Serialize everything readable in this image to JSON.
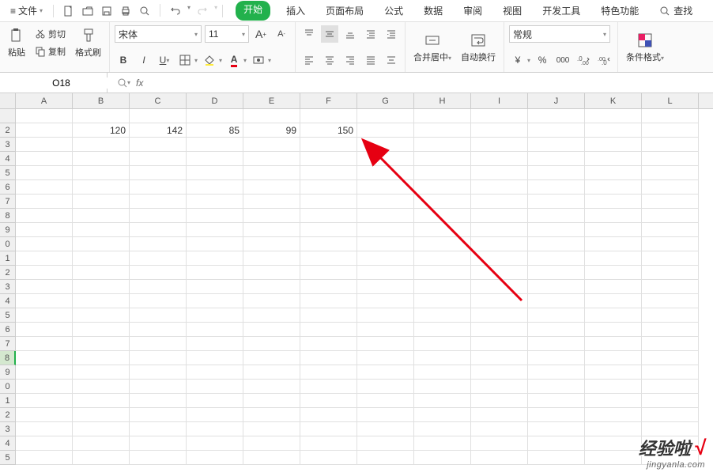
{
  "menu": {
    "file": "文件",
    "tabs": [
      "开始",
      "插入",
      "页面布局",
      "公式",
      "数据",
      "审阅",
      "视图",
      "开发工具",
      "特色功能"
    ],
    "active_tab": 0,
    "search": "查找"
  },
  "clipboard": {
    "paste": "粘贴",
    "cut": "剪切",
    "copy": "复制",
    "format_painter": "格式刷"
  },
  "font": {
    "name": "宋体",
    "size": "11",
    "inc": "A",
    "dec": "A"
  },
  "merge": {
    "label": "合并居中"
  },
  "wrap": {
    "label": "自动换行"
  },
  "number_format": {
    "value": "常规"
  },
  "cond_format": {
    "label": "条件格式"
  },
  "namebox": {
    "value": "O18"
  },
  "columns": [
    "A",
    "B",
    "C",
    "D",
    "E",
    "F",
    "G",
    "H",
    "I",
    "J",
    "K",
    "L"
  ],
  "row_headers": [
    "",
    "2",
    "3",
    "4",
    "5",
    "6",
    "7",
    "8",
    "9",
    "0",
    "1",
    "2",
    "3",
    "4",
    "5",
    "6",
    "7",
    "8",
    "9",
    "0",
    "1",
    "2",
    "3",
    "4",
    "5"
  ],
  "selected_row_index": 17,
  "cells": {
    "r2": {
      "B": "120",
      "C": "142",
      "D": "85",
      "E": "99",
      "F": "150"
    }
  },
  "watermark": {
    "main": "经验啦",
    "check": "√",
    "sub": "jingyanla.com"
  }
}
